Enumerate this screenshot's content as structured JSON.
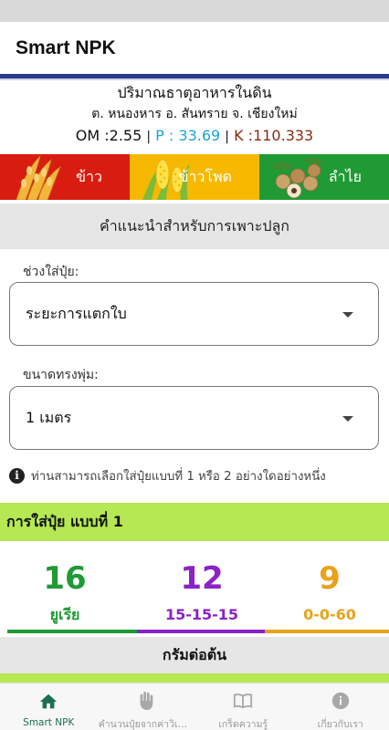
{
  "app": {
    "title": "Smart NPK"
  },
  "soil": {
    "title": "ปริมาณธาตุอาหารในดิน",
    "location": "ต. หนองหาร อ. สันทราย จ. เชียงใหม่",
    "om_label": "OM :2.55",
    "p_label": "P : 33.69",
    "k_label": "K :110.333",
    "separator": "|"
  },
  "crops": [
    {
      "label": "ข้าว",
      "icon": "rice-icon",
      "color": "#d81c10"
    },
    {
      "label": "ข้าวโพด",
      "icon": "corn-icon",
      "color": "#f7b900"
    },
    {
      "label": "ลำไย",
      "icon": "longan-icon",
      "color": "#1f9a34"
    }
  ],
  "advice": {
    "header": "คำแนะนำสำหรับการเพาะปลูก"
  },
  "form": {
    "stage_label": "ช่วงใส่ปุ๋ย:",
    "stage_value": "ระยะการแตกใบ",
    "canopy_label": "ขนาดทรงพุ่ม:",
    "canopy_value": "1 เมตร",
    "note": "ท่านสามารถเลือกใส่ปุ๋ยแบบที่ 1 หรือ 2 อย่างใดอย่างหนึ่ง"
  },
  "plan1": {
    "header": "การใส่ปุ๋ย แบบที่ 1",
    "fertilizers": [
      {
        "amount": "16",
        "name": "ยูเรีย",
        "color": "#1f9a34"
      },
      {
        "amount": "12",
        "name": "15-15-15",
        "color": "#8a22c8"
      },
      {
        "amount": "9",
        "name": "0-0-60",
        "color": "#e9a21b"
      }
    ],
    "unit": "กรัมต่อต้น"
  },
  "nav": [
    {
      "label": "Smart NPK",
      "icon": "home-icon",
      "active": true
    },
    {
      "label": "คำนวนปุ๋ยจากค่าวิเคราะห์ดิน",
      "icon": "hand-icon",
      "active": false
    },
    {
      "label": "เกร็ดความรู้",
      "icon": "book-icon",
      "active": false
    },
    {
      "label": "เกี่ยวกับเรา",
      "icon": "info-icon",
      "active": false
    }
  ],
  "colors": {
    "accent": "#2a3c8e",
    "plan_header": "#b5e853",
    "nav_active": "#1e6d55"
  }
}
